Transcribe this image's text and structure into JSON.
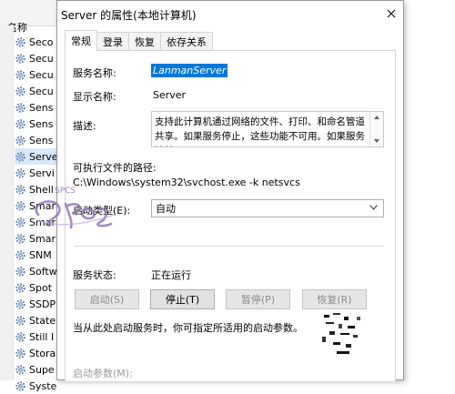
{
  "background_list": {
    "header_label": "名称",
    "items": [
      {
        "label": "Seco"
      },
      {
        "label": "Secu"
      },
      {
        "label": "Secu"
      },
      {
        "label": "Secu"
      },
      {
        "label": "Sens"
      },
      {
        "label": "Sens"
      },
      {
        "label": "Sens"
      },
      {
        "label": "Serve"
      },
      {
        "label": "Servi"
      },
      {
        "label": "Shell"
      },
      {
        "label": "Smar"
      },
      {
        "label": "Smar"
      },
      {
        "label": "Smar"
      },
      {
        "label": "SNM"
      },
      {
        "label": "Softw"
      },
      {
        "label": "Spot"
      },
      {
        "label": "SSDP"
      },
      {
        "label": "State"
      },
      {
        "label": "Still I"
      },
      {
        "label": "Stora"
      },
      {
        "label": "Supe"
      },
      {
        "label": "Syste"
      }
    ]
  },
  "dialog": {
    "title": "Server 的属性(本地计算机)",
    "tabs": [
      {
        "label": "常规"
      },
      {
        "label": "登录"
      },
      {
        "label": "恢复"
      },
      {
        "label": "依存关系"
      }
    ],
    "service_name_label": "服务名称:",
    "service_name_value": "LanmanServer",
    "display_name_label": "显示名称:",
    "display_name_value": "Server",
    "description_label": "描述:",
    "description_text": "支持此计算机通过网络的文件、打印、和命名管道共享。如果服务停止，这些功能不可用。如果服务被禁用，",
    "exe_path_label": "可执行文件的路径:",
    "exe_path_value": "C:\\Windows\\system32\\svchost.exe -k netsvcs",
    "startup_type_label": "启动类型(E):",
    "startup_type_value": "自动",
    "status_label": "服务状态:",
    "status_value": "正在运行",
    "buttons": {
      "start": "启动(S)",
      "stop": "停止(T)",
      "pause": "暂停(P)",
      "resume": "恢复(R)"
    },
    "hint_text": "当从此处启动服务时，你可指定所适用的启动参数。",
    "start_params_label": "启动参数(M):"
  },
  "watermark_text": "SPCS"
}
